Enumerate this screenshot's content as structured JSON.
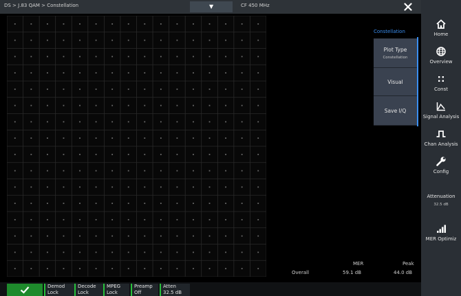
{
  "header": {
    "breadcrumb": "DS > J.83 QAM > Constellation",
    "center_frequency": "CF 450 MHz",
    "close_icon": "close-icon",
    "dropdown_icon": "chevron-down-icon"
  },
  "plot": {
    "constellation_order": 256,
    "grid_divisions": 16,
    "colors": {
      "background": "#080808",
      "grid": "#2a2a2a",
      "grid_minor": "#161616",
      "points": "#6a6a6a"
    }
  },
  "menu": {
    "title": "Constellation",
    "items": [
      {
        "label": "Plot Type",
        "sub": "Constellation"
      },
      {
        "label": "Visual",
        "sub": ""
      },
      {
        "label": "Save I/Q",
        "sub": ""
      }
    ]
  },
  "results": {
    "col_mer": "MER",
    "col_peak": "Peak",
    "row_label": "Overall",
    "mer_value": "59.1 dB",
    "peak_value": "44.0 dB"
  },
  "sidebar": {
    "items": [
      {
        "label": "Home",
        "icon": "home-icon"
      },
      {
        "label": "Overview",
        "icon": "globe-icon"
      },
      {
        "label": "Const",
        "icon": "constellation-icon"
      },
      {
        "label": "Signal Analysis",
        "icon": "chart-line-icon"
      },
      {
        "label": "Chan Analysis",
        "icon": "pulse-icon"
      },
      {
        "label": "Config",
        "icon": "wrench-icon"
      }
    ],
    "attenuation": {
      "label": "Attenuation",
      "value": "32.5 dB"
    },
    "mer_optimize": {
      "label": "MER Optimiz",
      "icon": "signal-bars-icon"
    }
  },
  "status": {
    "ok_icon": "checkmark-icon",
    "items": [
      {
        "l1": "Demod",
        "l2": "Lock"
      },
      {
        "l1": "Decode",
        "l2": "Lock"
      },
      {
        "l1": "MPEG",
        "l2": "Lock"
      },
      {
        "l1": "Preamp",
        "l2": "Off"
      },
      {
        "l1": "Atten",
        "l2": "32.5 dB"
      }
    ]
  },
  "colors": {
    "accent": "#3a8ef0",
    "status_ok": "#27c23b",
    "panel": "#2a2f35",
    "menu_button": "#3a4250"
  }
}
